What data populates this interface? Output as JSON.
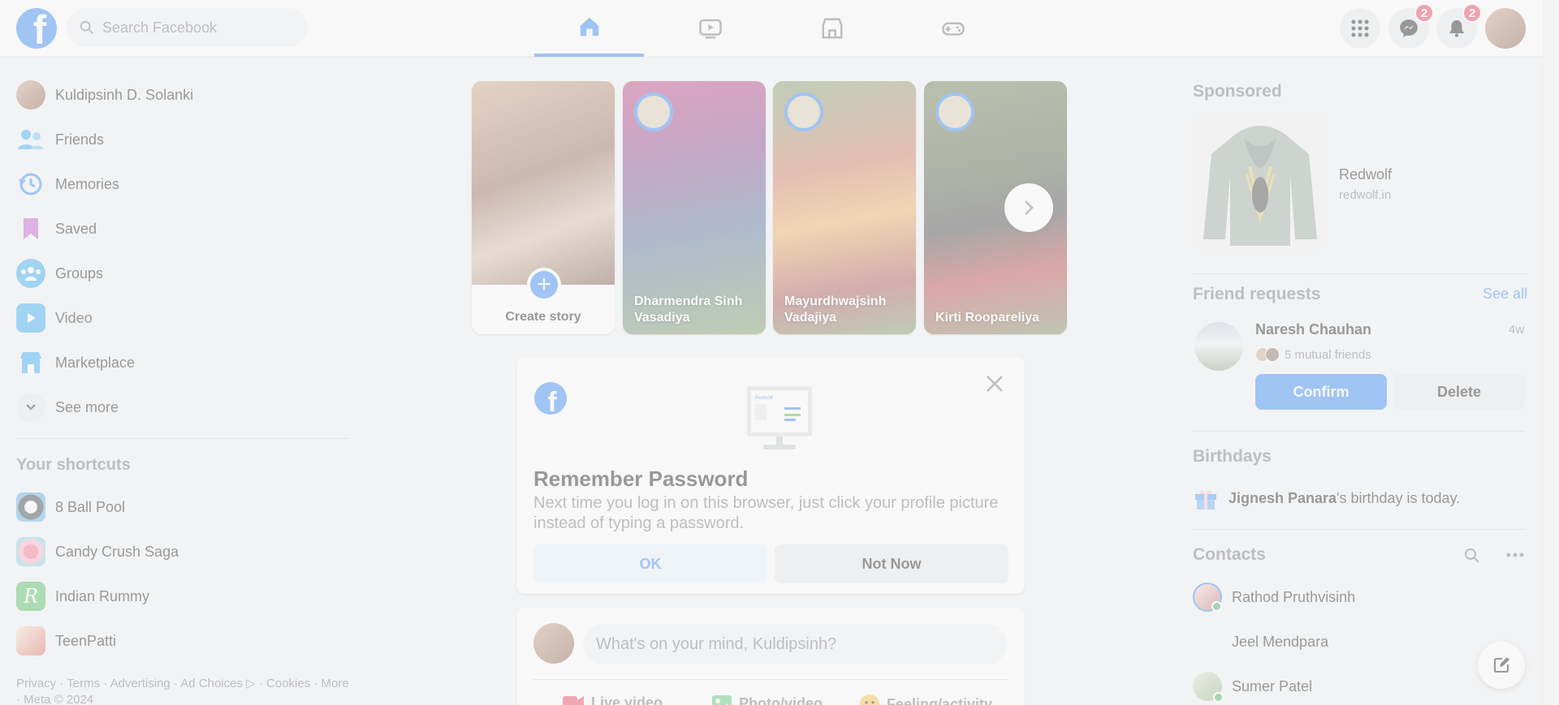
{
  "colors": {
    "brand": "#1877f2",
    "background": "#f0f2f5",
    "badge": "#e41e3f",
    "online": "#31a24c"
  },
  "topbar": {
    "search_placeholder": "Search Facebook",
    "messenger_badge": "2",
    "notifications_badge": "2",
    "nav_tabs": [
      "home-icon",
      "video-icon",
      "marketplace-icon",
      "gaming-icon"
    ]
  },
  "left_sidebar": {
    "items": [
      {
        "label": "Kuldipsinh D. Solanki",
        "icon": "avatar"
      },
      {
        "label": "Friends",
        "icon": "friends-icon"
      },
      {
        "label": "Memories",
        "icon": "memories-icon"
      },
      {
        "label": "Saved",
        "icon": "saved-icon"
      },
      {
        "label": "Groups",
        "icon": "groups-icon"
      },
      {
        "label": "Video",
        "icon": "video-icon"
      },
      {
        "label": "Marketplace",
        "icon": "marketplace-icon"
      },
      {
        "label": "See more",
        "icon": "chevron-down-icon"
      }
    ],
    "shortcuts_title": "Your shortcuts",
    "shortcuts": [
      {
        "label": "8 Ball Pool"
      },
      {
        "label": "Candy Crush Saga"
      },
      {
        "label": "Indian Rummy"
      },
      {
        "label": "TeenPatti"
      }
    ],
    "footer": "Privacy · Terms · Advertising · Ad Choices ▷ · Cookies · More · Meta © 2024"
  },
  "stories": {
    "create_label": "Create story",
    "items": [
      {
        "name": "Dharmendra Sinh Vasadiya"
      },
      {
        "name": "Mayurdhwajsinh Vadajiya"
      },
      {
        "name": "Kirti Roopareliya"
      }
    ]
  },
  "remember_password": {
    "title": "Remember Password",
    "text": "Next time you log in on this browser, just click your profile picture instead of typing a password.",
    "ok_label": "OK",
    "not_now_label": "Not Now",
    "illustration_text": "Redwolf"
  },
  "composer": {
    "placeholder": "What's on your mind, Kuldipsinh?",
    "actions": [
      "Live video",
      "Photo/video",
      "Feeling/activity"
    ]
  },
  "right_sidebar": {
    "sponsored_title": "Sponsored",
    "ad": {
      "name": "Redwolf",
      "url": "redwolf.in"
    },
    "friend_requests_title": "Friend requests",
    "see_all": "See all",
    "request": {
      "name": "Naresh Chauhan",
      "time": "4w",
      "mutual": "5 mutual friends",
      "confirm": "Confirm",
      "delete": "Delete"
    },
    "birthdays_title": "Birthdays",
    "birthday_name": "Jignesh Panara",
    "birthday_text": "'s birthday is today.",
    "contacts_title": "Contacts",
    "contacts": [
      {
        "name": "Rathod Pruthvisinh",
        "online": true
      },
      {
        "name": "Jeel Mendpara",
        "online": false
      },
      {
        "name": "Sumer Patel",
        "online": true
      }
    ]
  }
}
